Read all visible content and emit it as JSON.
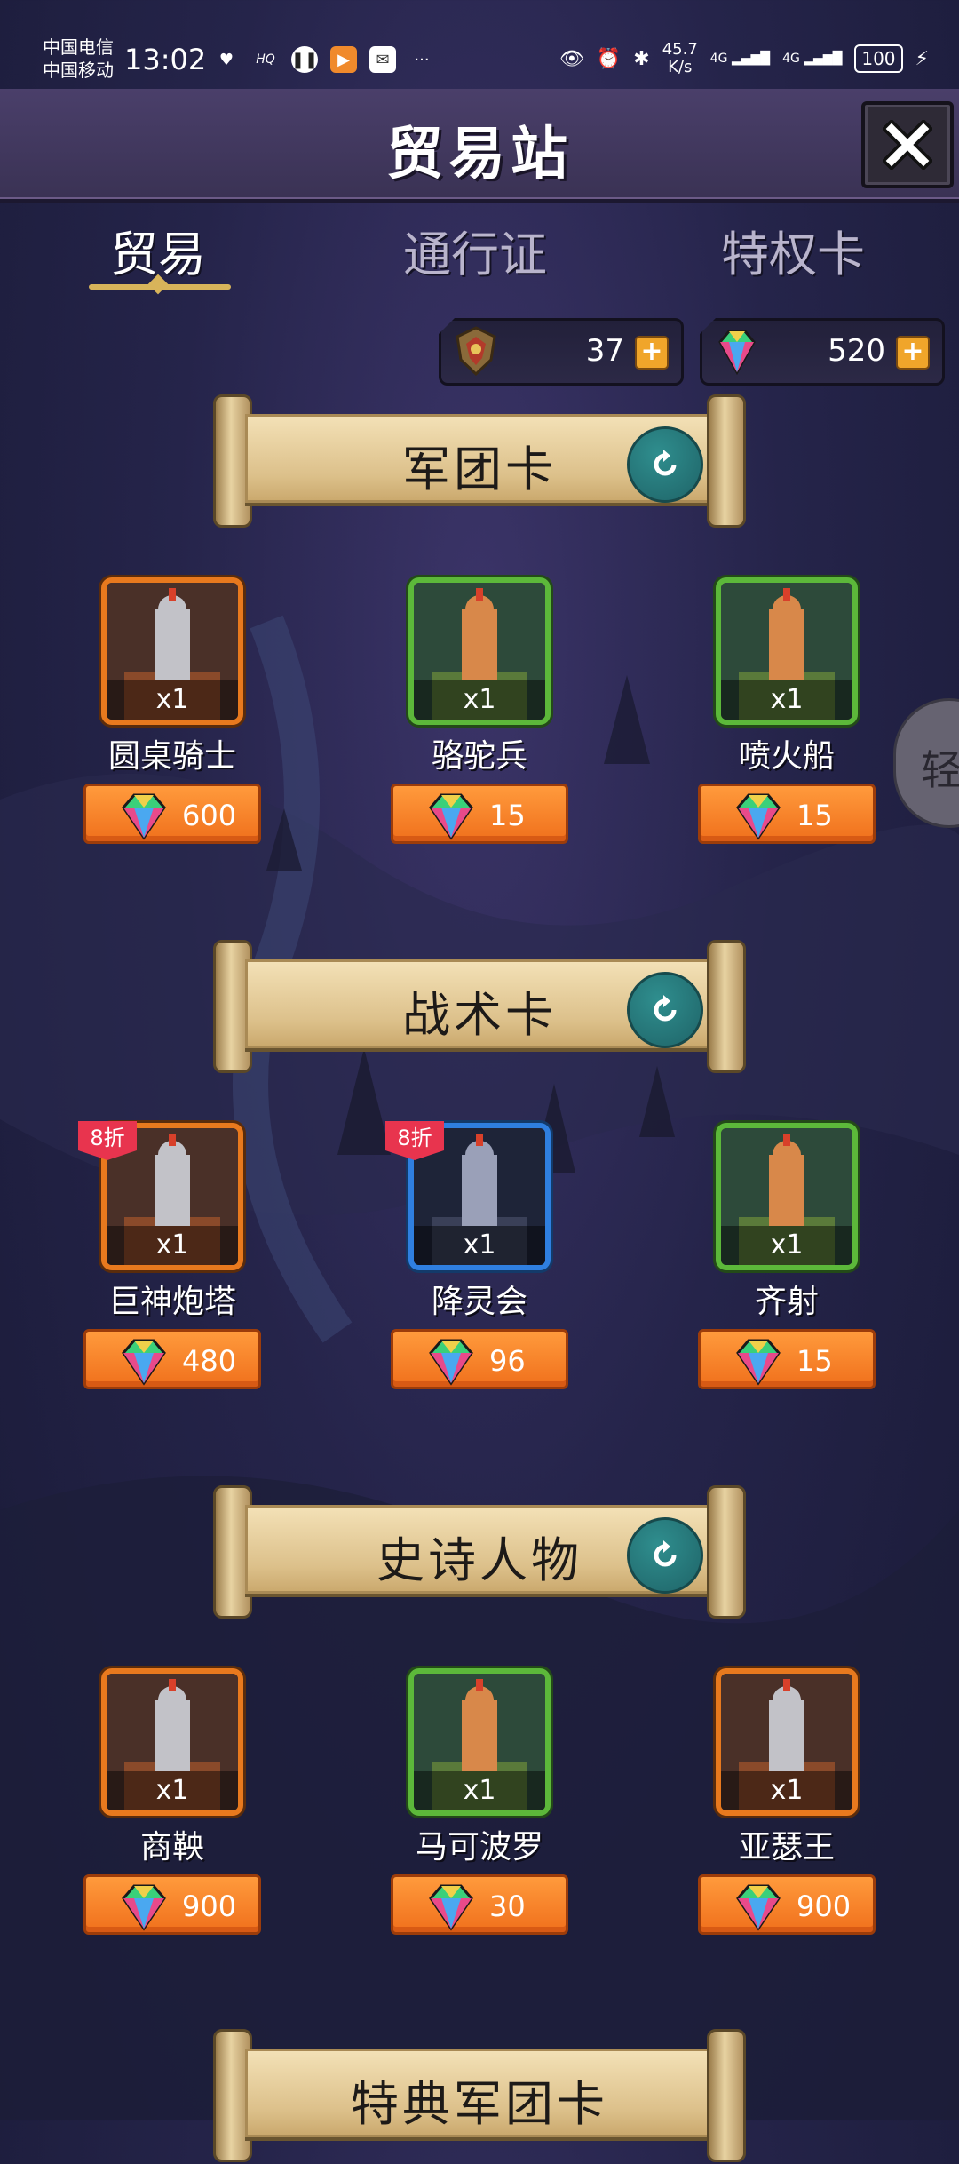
{
  "status_bar": {
    "carrier1": "中国电信",
    "carrier2": "中国移动",
    "time": "13:02",
    "net_speed_value": "45.7",
    "net_speed_unit": "K/s",
    "signal1": "4G",
    "signal2": "4G",
    "battery": "100"
  },
  "header": {
    "title": "贸易站"
  },
  "tabs": [
    {
      "label": "贸易",
      "active": true
    },
    {
      "label": "通行证",
      "active": false
    },
    {
      "label": "特权卡",
      "active": false
    }
  ],
  "currency": {
    "crest_value": "37",
    "gem_value": "520"
  },
  "sections": [
    {
      "title": "军团卡",
      "items": [
        {
          "name": "圆桌骑士",
          "qty": "x1",
          "price": "600",
          "rarity": "orange"
        },
        {
          "name": "骆驼兵",
          "qty": "x1",
          "price": "15",
          "rarity": "green"
        },
        {
          "name": "喷火船",
          "qty": "x1",
          "price": "15",
          "rarity": "green"
        }
      ]
    },
    {
      "title": "战术卡",
      "items": [
        {
          "name": "巨神炮塔",
          "qty": "x1",
          "price": "480",
          "rarity": "orange",
          "badge": "8折"
        },
        {
          "name": "降灵会",
          "qty": "x1",
          "price": "96",
          "rarity": "blue",
          "badge": "8折"
        },
        {
          "name": "齐射",
          "qty": "x1",
          "price": "15",
          "rarity": "green"
        }
      ]
    },
    {
      "title": "史诗人物",
      "items": [
        {
          "name": "商鞅",
          "qty": "x1",
          "price": "900",
          "rarity": "orange"
        },
        {
          "name": "马可波罗",
          "qty": "x1",
          "price": "30",
          "rarity": "green"
        },
        {
          "name": "亚瑟王",
          "qty": "x1",
          "price": "900",
          "rarity": "orange"
        }
      ]
    },
    {
      "title": "特典军团卡"
    }
  ],
  "side_float_label": "轻"
}
